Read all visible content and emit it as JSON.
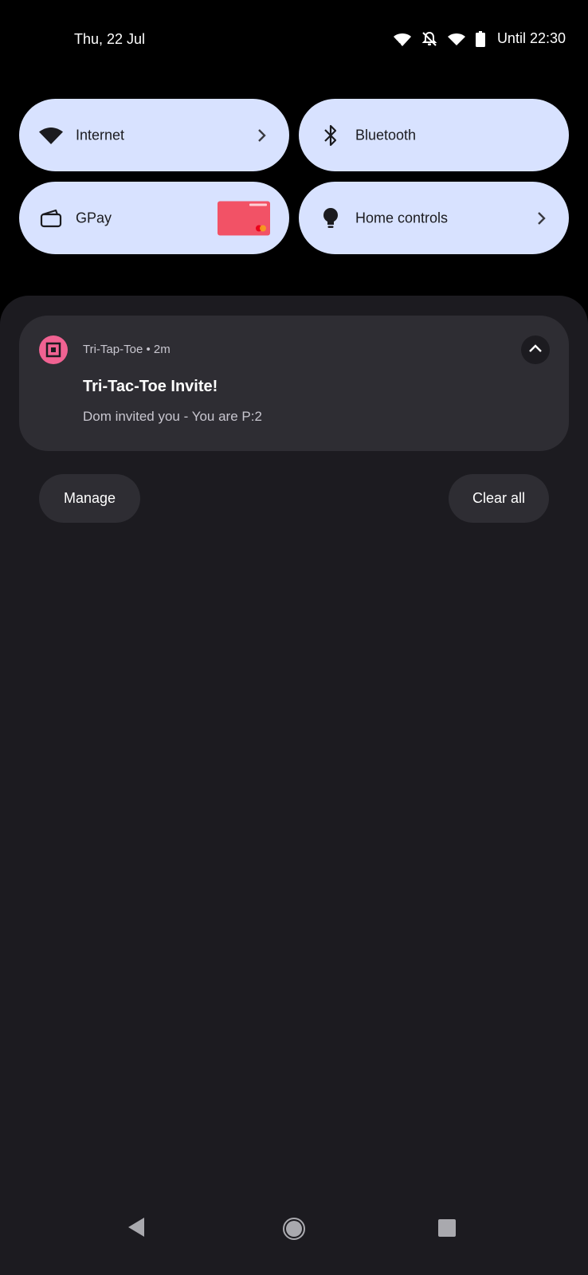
{
  "status_bar": {
    "date": "Thu, 22 Jul",
    "battery_text": "Until 22:30",
    "icons": [
      "wifi-calling-icon",
      "notifications-off-icon",
      "wifi-icon",
      "battery-icon"
    ]
  },
  "quick_tiles": [
    {
      "label": "Internet",
      "icon": "wifi-icon",
      "has_chevron": true
    },
    {
      "label": "Bluetooth",
      "icon": "bluetooth-icon",
      "has_chevron": false
    },
    {
      "label": "GPay",
      "icon": "wallet-icon",
      "card_color": "#f25266"
    },
    {
      "label": "Home controls",
      "icon": "lightbulb-icon",
      "has_chevron": true
    }
  ],
  "notification": {
    "app_name": "Tri-Tap-Toe",
    "time": "2m",
    "meta": "Tri-Tap-Toe • 2m",
    "title": "Tri-Tac-Toe Invite!",
    "text": "Dom invited you - You are P:2",
    "icon_color": "#f06292"
  },
  "actions": {
    "manage_label": "Manage",
    "clear_label": "Clear all"
  },
  "colors": {
    "tile_bg": "#d8e2ff",
    "shade_bg": "#1c1b20",
    "card_bg": "#2e2d33"
  }
}
